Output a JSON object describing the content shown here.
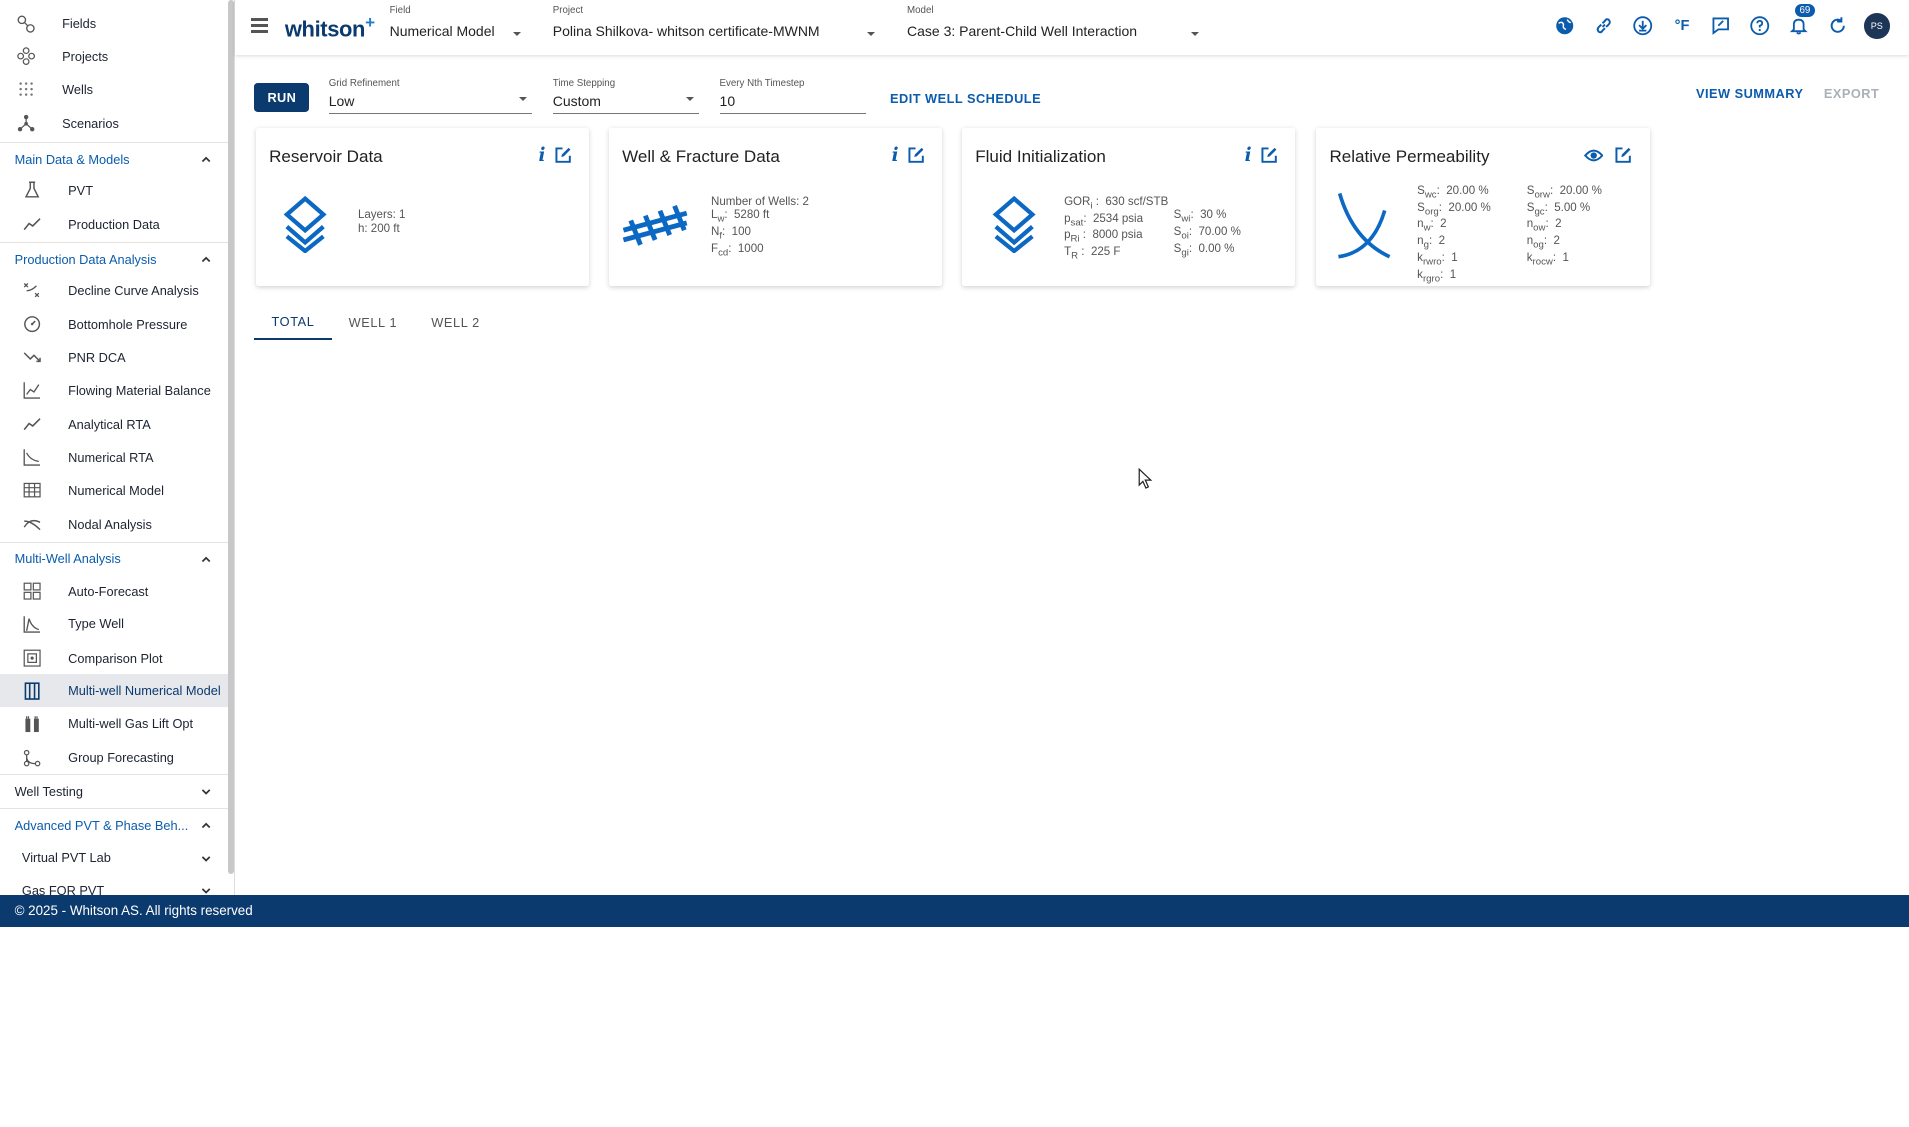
{
  "sidebar": {
    "top_items": [
      {
        "label": "Fields",
        "icon": "fields-icon"
      },
      {
        "label": "Projects",
        "icon": "projects-icon"
      },
      {
        "label": "Wells",
        "icon": "wells-icon"
      },
      {
        "label": "Scenarios",
        "icon": "scenarios-icon"
      }
    ],
    "sections": [
      {
        "label": "Main Data & Models",
        "items": [
          "PVT",
          "Production Data"
        ]
      },
      {
        "label": "Production Data Analysis",
        "items": [
          "Decline Curve Analysis",
          "Bottomhole Pressure",
          "PNR DCA",
          "Flowing Material Balance",
          "Analytical RTA",
          "Numerical RTA",
          "Numerical Model",
          "Nodal Analysis"
        ]
      },
      {
        "label": "Multi-Well Analysis",
        "items": [
          "Auto-Forecast",
          "Type Well",
          "Comparison Plot",
          "Multi-well Numerical Model",
          "Multi-well Gas Lift Opt",
          "Group Forecasting"
        ]
      },
      {
        "label": "Well Testing"
      },
      {
        "label": "Advanced PVT & Phase Beh..."
      },
      {
        "label": "Virtual PVT Lab"
      },
      {
        "label": "Gas FOR PVT"
      }
    ]
  },
  "header": {
    "logo": "whitson",
    "logo_sup": "+",
    "field_caption": "Field",
    "field_value": "Numerical Model",
    "project_caption": "Project",
    "project_value": "Polina Shilkova- whitson certificate-MWNM",
    "model_caption": "Model",
    "model_value": "Case 3: Parent-Child Well Interaction",
    "temp_unit": "°F",
    "notifications": "69",
    "avatar": "PS"
  },
  "toolbar": {
    "run": "RUN",
    "grid_caption": "Grid Refinement",
    "grid_value": "Low",
    "time_caption": "Time Stepping",
    "time_value": "Custom",
    "nth_caption": "Every Nth Timestep",
    "nth_value": "10",
    "edit_schedule": "EDIT WELL SCHEDULE",
    "view_summary": "VIEW SUMMARY",
    "export": "EXPORT"
  },
  "cards": {
    "reservoir": {
      "title": "Reservoir Data",
      "layers": "Layers:  1",
      "h": "h:  200 ft"
    },
    "well": {
      "title": "Well & Fracture Data",
      "n_wells": "Number of Wells:  2",
      "lw": "5280 ft",
      "nf": "100",
      "fcd": "1000"
    },
    "fluid": {
      "title": "Fluid Initialization",
      "gor": "630 scf/STB",
      "psat": "2534 psia",
      "pri": "8000 psia",
      "tr": "225 F",
      "swi": "30 %",
      "soi": "70.00 %",
      "sgi": "0.00 %"
    },
    "relperm": {
      "title": "Relative Permeability",
      "swc": "20.00 %",
      "sorg": "20.00 %",
      "nw": "2",
      "ng": "2",
      "krwro": "1",
      "krgro": "1",
      "sorw": "20.00 %",
      "sgc": "5.00 %",
      "now": "2",
      "nog": "2",
      "krocw": "1"
    }
  },
  "tabs": [
    "TOTAL",
    "WELL 1",
    "WELL 2"
  ],
  "footer": "© 2025 - Whitson AS. All rights reserved",
  "colors": {
    "primary": "#0b3a6e",
    "accent": "#0b5cad",
    "icon_blue": "#1b7fd1"
  }
}
